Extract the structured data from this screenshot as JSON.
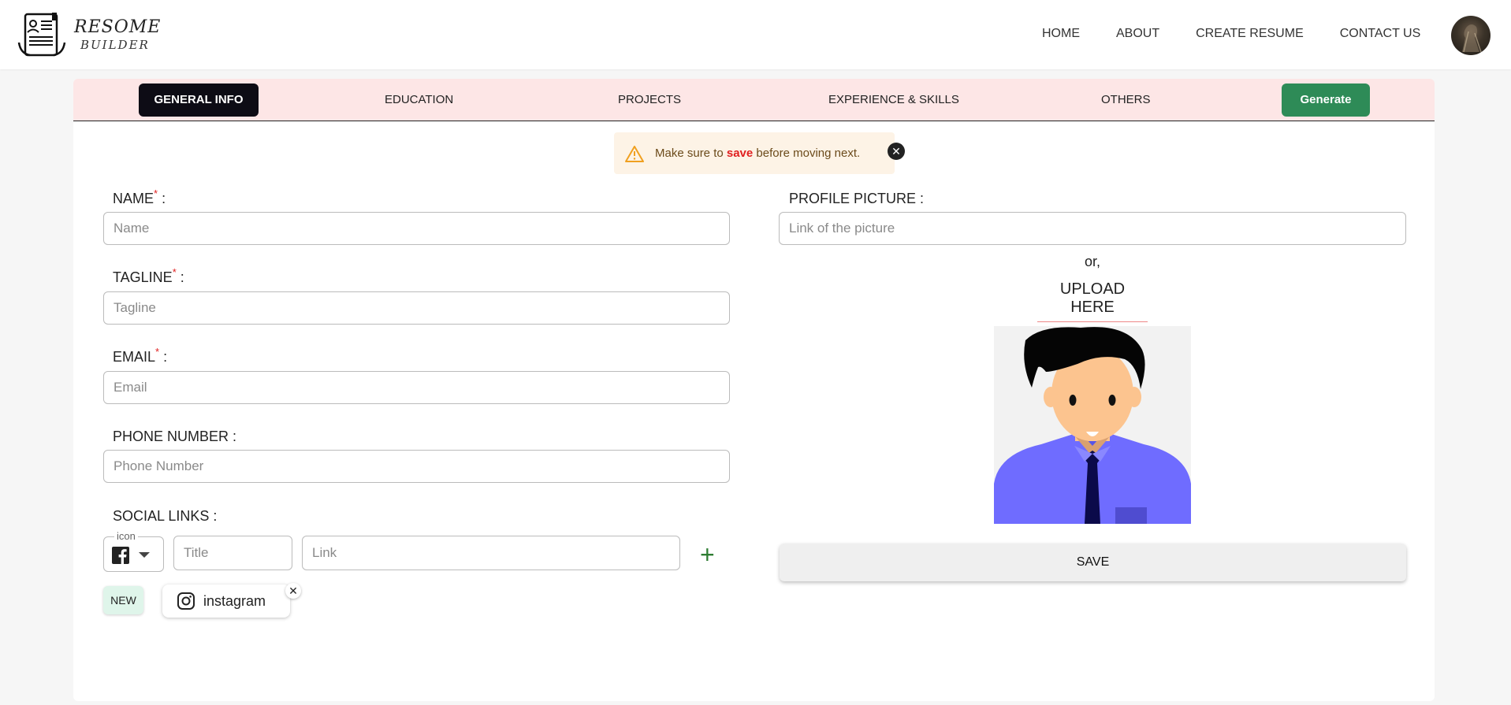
{
  "brand": {
    "line1": "RESOME",
    "line2": "BUILDER"
  },
  "nav": {
    "items": [
      "HOME",
      "ABOUT",
      "CREATE RESUME",
      "CONTACT US"
    ]
  },
  "tabs": {
    "items": [
      "GENERAL INFO",
      "EDUCATION",
      "PROJECTS",
      "EXPERIENCE & SKILLS",
      "OTHERS"
    ],
    "active": "GENERAL INFO",
    "generate_label": "Generate"
  },
  "alert": {
    "prefix": "Make sure to ",
    "emphasis": "save",
    "suffix": " before moving next.",
    "close_glyph": "✕"
  },
  "form": {
    "name": {
      "label": "NAME",
      "required": "*",
      "colon": " :",
      "placeholder": "Name",
      "value": ""
    },
    "tagline": {
      "label": "TAGLINE",
      "required": "*",
      "colon": " :",
      "placeholder": "Tagline",
      "value": ""
    },
    "email": {
      "label": "EMAIL",
      "required": "*",
      "colon": " :",
      "placeholder": "Email",
      "value": ""
    },
    "phone": {
      "label": "PHONE NUMBER :",
      "placeholder": "Phone Number",
      "value": ""
    },
    "social": {
      "label": "SOCIAL LINKS :",
      "icon_legend": "icon",
      "selected_icon": "facebook-icon",
      "title_placeholder": "Title",
      "link_placeholder": "Link",
      "add_glyph": "+"
    },
    "chips": {
      "new_label": "NEW",
      "items": [
        {
          "label": "instagram",
          "icon": "instagram-icon"
        }
      ],
      "remove_glyph": "✕"
    }
  },
  "profile": {
    "label": "PROFILE PICTURE :",
    "placeholder": "Link of the picture",
    "or_text": "or,",
    "upload_label": "UPLOAD HERE",
    "save_label": "SAVE"
  },
  "colors": {
    "tab_bar_bg": "#fde6e6",
    "active_tab": "#0d0c15",
    "generate": "#2e8b57",
    "required": "#e02020",
    "alert_bg": "#fdf3e6"
  }
}
